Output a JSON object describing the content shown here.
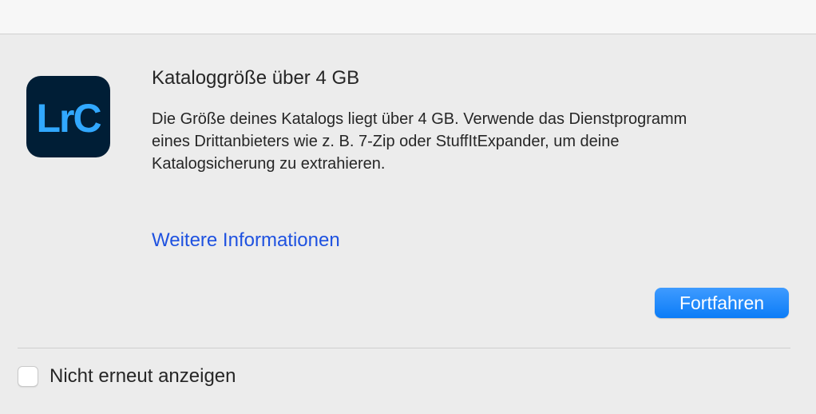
{
  "dialog": {
    "app_icon_text": "LrC",
    "title": "Kataloggröße über 4 GB",
    "message_lines": [
      "Die Größe deines Katalogs liegt über 4 GB. Verwende das Dienstprogramm",
      "eines Drittanbieters wie z. B. 7-Zip oder StuffItExpander, um deine",
      "Katalogsicherung zu extrahieren."
    ],
    "more_info_link": "Weitere Informationen",
    "continue_button": "Fortfahren",
    "dont_show_again_label": "Nicht erneut anzeigen",
    "dont_show_again_checked": false
  },
  "colors": {
    "icon_background": "#001e36",
    "icon_text": "#31a8ff",
    "link": "#1f52e0",
    "button": "#0b7cf7"
  }
}
